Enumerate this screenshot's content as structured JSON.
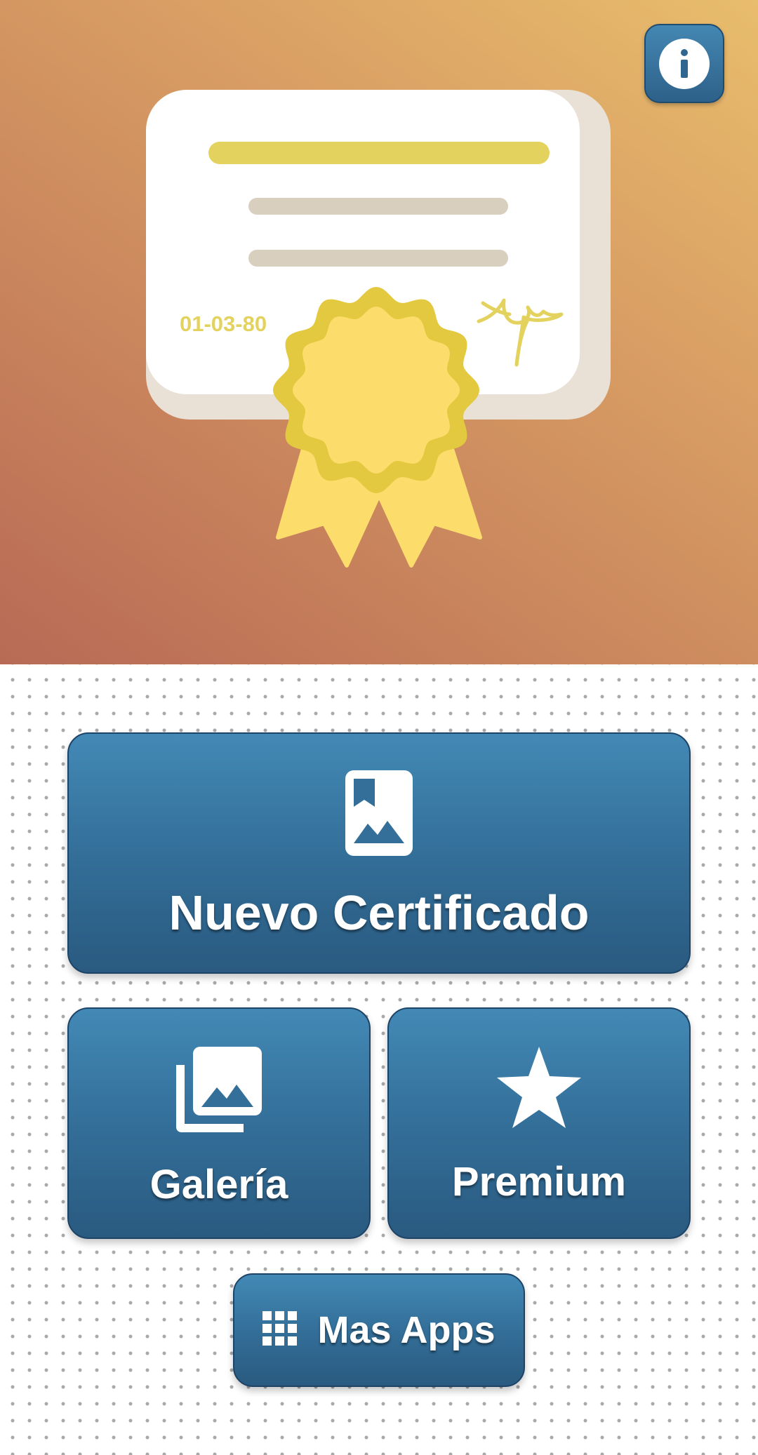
{
  "header": {
    "certificate_date": "01-03-80",
    "info_icon": "info-icon"
  },
  "actions": {
    "new_certificate": {
      "label": "Nuevo Certificado",
      "icon": "bookmark-image-icon"
    },
    "gallery": {
      "label": "Galería",
      "icon": "photo-library-icon"
    },
    "premium": {
      "label": "Premium",
      "icon": "star-icon"
    },
    "more_apps": {
      "label": "Mas Apps",
      "icon": "grid-icon"
    }
  },
  "colors": {
    "button_blue": "#336f99",
    "hero_gradient_start": "#b86a55",
    "hero_gradient_end": "#e8bd6c",
    "ribbon_yellow": "#fcdd6c",
    "ribbon_dark_yellow": "#e3c940"
  }
}
